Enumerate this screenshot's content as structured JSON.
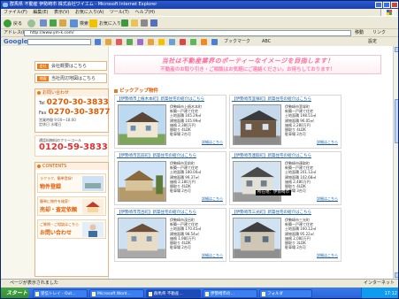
{
  "window": {
    "title": "群馬県 不動産 伊勢崎市 株式会社ワイエム - Microsoft Internet Explorer"
  },
  "menu": [
    "ファイル(F)",
    "編集(E)",
    "表示(V)",
    "お気に入り(A)",
    "ツール(T)",
    "ヘルプ(H)"
  ],
  "toolbar": {
    "back": "戻る",
    "search": "検索",
    "favorites": "お気に入り"
  },
  "address": {
    "label": "アドレス(D)",
    "url": "http://www.ym-k.com/",
    "go": "移動",
    "links": "リンク"
  },
  "google_bar": {
    "logo": "Google",
    "bookmarks": "ブックマーク",
    "settings": "設定"
  },
  "side": {
    "btn1": {
      "tag": "会社",
      "label": "会社概要はこちら"
    },
    "btn2": {
      "tag": "地図",
      "label": "当社周辺地図はこちら"
    },
    "inquiry_title": "お問い合わせ",
    "tel_label": "Tel",
    "tel": "0270-30-3833",
    "fax_label": "Fax",
    "fax": "0270-30-3877",
    "hours": "営業時間 9:00〜18:00",
    "holiday": "定休日 水曜日",
    "free_title": "通話料無料のフリーコール",
    "free_number": "0120-59-3833",
    "contents_title": "CONTENTS",
    "links": [
      {
        "t1": "ラクラク、簡単登録！",
        "t2": "物件登録"
      },
      {
        "t1": "簡単に物件を検索！",
        "t2": "売却・査定依頼"
      },
      {
        "t1": "ご質問・ご相談はこちら",
        "t2": "お問い合わせ"
      }
    ]
  },
  "main": {
    "banner_line1": "当社は不動産業界のポーティーなイメージを目指します！",
    "banner_line2": "不動産のお取り引き・ご相談はお気軽にご連絡ください。お待ちしております！",
    "pickup_title": "ピックアップ物件",
    "tooltip": "所在地：伊勢崎市",
    "more": "詳細はこちら",
    "cards": [
      {
        "title": "【伊勢崎市上植木本町】新築住宅の紹介はこちら",
        "detail": "伊勢崎市上植木本町\n新築一戸建て住宅\n土地面積 165.29㎡\n建物面積 105.99㎡\n価格 2,380万円\n間取り 4LDK\n駐車場 2台可"
      },
      {
        "title": "【伊勢崎市韮塚町】新築住宅の紹介はこちら",
        "detail": "伊勢崎市韮塚町\n新築一戸建て住宅\n土地面積 198.51㎡\n建物面積 96.05㎡\n価格 2,280万円\n間取り 4LDK\n駐車場 2台可"
      },
      {
        "title": "【伊勢崎市宮前町】新築住宅の紹介はこちら",
        "detail": "伊勢崎市宮前町\n新築一戸建て住宅\n土地面積 180.00㎡\n建物面積 99.37㎡\n価格 2,180万円\n間取り 4LDK\n駐車場 2台可"
      },
      {
        "title": "【伊勢崎市連取町】新築住宅の紹介はこちら",
        "detail": "伊勢崎市連取町\n新築一戸建て住宅\n土地面積 201.12㎡\n建物面積 102.68㎡\n価格 2,480万円\n間取り 4LDK\n駐車場 3台可"
      },
      {
        "title": "【伊勢崎市茂呂町】新築住宅の紹介はこちら",
        "detail": "伊勢崎市茂呂町\n新築一戸建て住宅\n土地面積 170.45㎡\n建物面積 98.54㎡\n価格 1,980万円\n間取り 4LDK\n駐車場 2台可"
      },
      {
        "title": "【伊勢崎市三光町】新築住宅の紹介はこちら",
        "detail": "伊勢崎市三光町\n新築一戸建て住宅\n土地面積 160.12㎡\n建物面積 95.22㎡\n価格 2,080万円\n間取り 3LDK\n駐車場 2台可"
      }
    ]
  },
  "status": {
    "text": "ページが表示されました",
    "zone": "インターネット"
  },
  "taskbar": {
    "start": "スタート",
    "tasks": [
      "受信トレイ - Out…",
      "Microsoft Word…",
      "群馬県 不動産…",
      "伊勢崎市の…",
      "フォルダ"
    ],
    "clock": "17:12"
  }
}
